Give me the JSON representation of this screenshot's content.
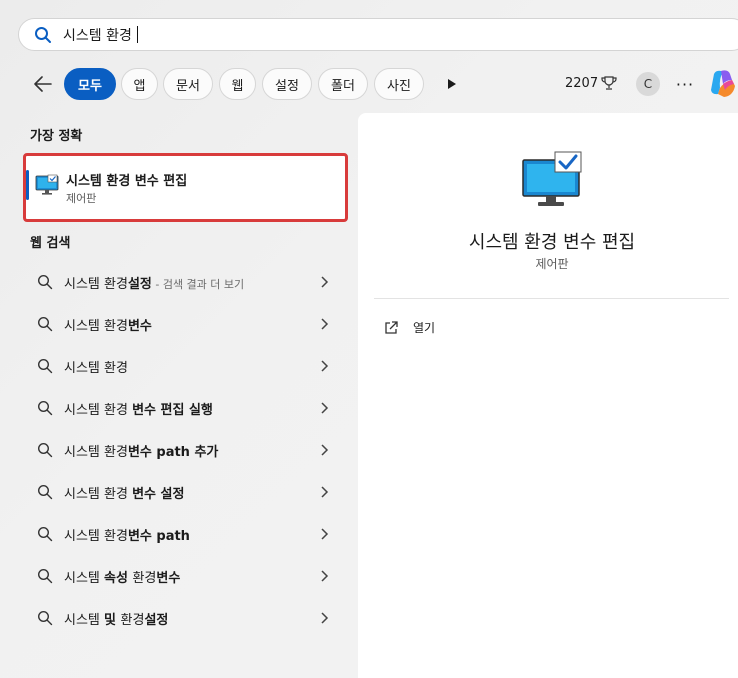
{
  "search": {
    "query": "시스템 환경"
  },
  "filters": [
    "모두",
    "앱",
    "문서",
    "웹",
    "설정",
    "폴더",
    "사진"
  ],
  "header": {
    "points": "2207",
    "avatar_initial": "C",
    "more": "···"
  },
  "sections": {
    "best_match": "가장 정확",
    "web_search": "웹 검색"
  },
  "best_match": {
    "name": "시스템 환경 변수 편집",
    "category": "제어판"
  },
  "web_results": [
    {
      "normal": "시스템 환경",
      "bold": "설정",
      "sub": " - 검색 결과 더 보기"
    },
    {
      "normal": "시스템 환경",
      "bold": "변수",
      "sub": ""
    },
    {
      "normal": "시스템 환경",
      "bold": "",
      "sub": ""
    },
    {
      "normal": "시스템 환경 ",
      "bold": "변수 편집 실행",
      "sub": ""
    },
    {
      "normal": "시스템 환경",
      "bold": "변수 path 추가",
      "sub": ""
    },
    {
      "normal": "시스템 환경 ",
      "bold": "변수 설정",
      "sub": ""
    },
    {
      "normal": "시스템 환경",
      "bold": "변수 path",
      "sub": ""
    },
    {
      "normal": "시스템 ",
      "bold": "속성 ",
      "normal2": "환경",
      "bold2": "변수",
      "sub": ""
    },
    {
      "normal": "시스템 ",
      "bold": "및 ",
      "normal2": "환경",
      "bold2": "설정",
      "sub": ""
    }
  ],
  "preview": {
    "name": "시스템 환경 변수 편집",
    "category": "제어판",
    "open_label": "열기"
  },
  "colors": {
    "accent": "#0a5ec2",
    "highlight_border": "#d83b3b"
  }
}
